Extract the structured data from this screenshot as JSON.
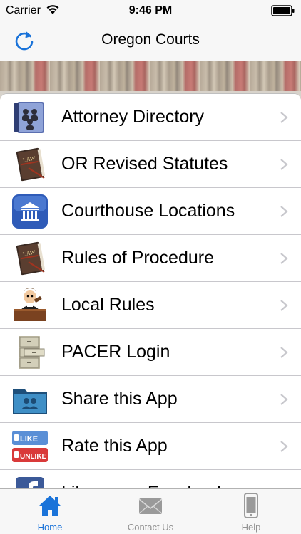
{
  "status_bar": {
    "carrier": "Carrier",
    "time": "9:46 PM"
  },
  "nav_bar": {
    "title": "Oregon Courts",
    "refresh_icon": "refresh-icon"
  },
  "list": {
    "items": [
      {
        "label": "Attorney Directory",
        "icon": "directory-book-icon"
      },
      {
        "label": "OR Revised Statutes",
        "icon": "law-book-icon"
      },
      {
        "label": "Courthouse Locations",
        "icon": "courthouse-icon"
      },
      {
        "label": "Rules of Procedure",
        "icon": "law-book-icon"
      },
      {
        "label": "Local Rules",
        "icon": "judge-icon"
      },
      {
        "label": "PACER Login",
        "icon": "file-cabinet-icon"
      },
      {
        "label": "Share this App",
        "icon": "share-folder-icon"
      },
      {
        "label": "Rate this App",
        "icon": "like-unlike-icon"
      },
      {
        "label": "Like us on Facebook",
        "icon": "facebook-icon"
      }
    ]
  },
  "tab_bar": {
    "tabs": [
      {
        "label": "Home",
        "icon": "home-icon",
        "active": true
      },
      {
        "label": "Contact Us",
        "icon": "envelope-icon",
        "active": false
      },
      {
        "label": "Help",
        "icon": "phone-icon",
        "active": false
      }
    ]
  },
  "colors": {
    "accent": "#1a73d9",
    "inactive": "#929292",
    "separator": "#c8c7cc",
    "bar_background": "#f7f7f7"
  }
}
